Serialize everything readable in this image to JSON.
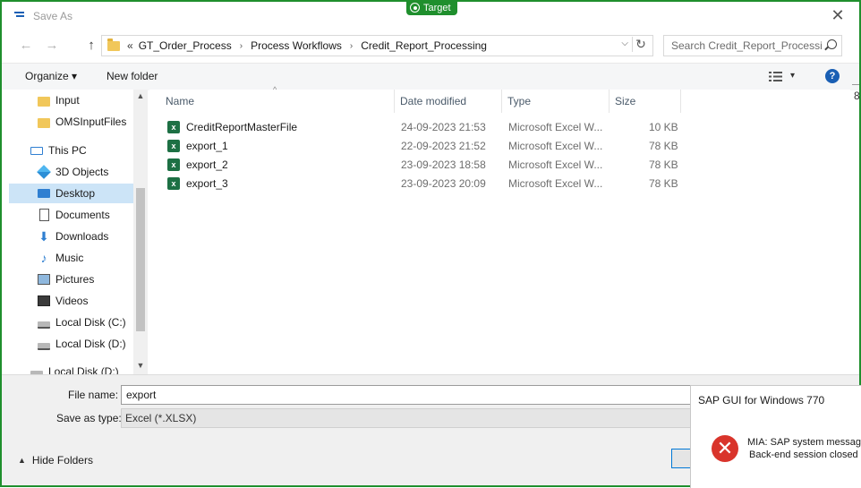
{
  "window": {
    "title": "Save As",
    "close_glyph": "✕"
  },
  "target_badge": "Target",
  "nav": {
    "back": "←",
    "forward": "→",
    "up": "↑"
  },
  "address": {
    "overflow": "«",
    "crumbs": [
      "GT_Order_Process",
      "Process Workflows",
      "Credit_Report_Processing"
    ],
    "separator": "›",
    "dropdown": "⌵",
    "refresh": "↻"
  },
  "search": {
    "placeholder": "Search Credit_Report_Processi..."
  },
  "toolbar": {
    "organize": "Organize ▾",
    "new_folder": "New folder",
    "view_dd": "▾",
    "help": "?"
  },
  "sidebar": {
    "items": [
      {
        "label": "Input",
        "icon": "folder-icon"
      },
      {
        "label": "OMSInputFiles",
        "icon": "folder-icon"
      },
      {
        "label": "This PC",
        "icon": "computer-icon"
      },
      {
        "label": "3D Objects",
        "icon": "cube-icon"
      },
      {
        "label": "Desktop",
        "icon": "desktop-icon",
        "selected": true
      },
      {
        "label": "Documents",
        "icon": "document-icon"
      },
      {
        "label": "Downloads",
        "icon": "download-icon"
      },
      {
        "label": "Music",
        "icon": "music-icon"
      },
      {
        "label": "Pictures",
        "icon": "pictures-icon"
      },
      {
        "label": "Videos",
        "icon": "videos-icon"
      },
      {
        "label": "Local Disk (C:)",
        "icon": "disk-icon"
      },
      {
        "label": "Local Disk (D:)",
        "icon": "disk-icon"
      },
      {
        "label": "Local Disk (D:)",
        "icon": "disk-icon"
      }
    ],
    "scroll_up": "▲",
    "scroll_down": "▼"
  },
  "columns": {
    "name": "Name",
    "date": "Date modified",
    "type": "Type",
    "size": "Size",
    "sort_caret": "^"
  },
  "files": [
    {
      "name": "CreditReportMasterFile",
      "date": "24-09-2023 21:53",
      "type": "Microsoft Excel W...",
      "size": "10 KB"
    },
    {
      "name": "export_1",
      "date": "22-09-2023 21:52",
      "type": "Microsoft Excel W...",
      "size": "78 KB"
    },
    {
      "name": "export_2",
      "date": "23-09-2023 18:58",
      "type": "Microsoft Excel W...",
      "size": "78 KB"
    },
    {
      "name": "export_3",
      "date": "23-09-2023 20:09",
      "type": "Microsoft Excel W...",
      "size": "78 KB"
    }
  ],
  "excel_icon_letter": "x",
  "bottom": {
    "file_name_label": "File name:",
    "file_name_value": "export",
    "save_type_label": "Save as type:",
    "save_type_value": "Excel (*.XLSX)",
    "hide_folders": "Hide Folders",
    "hide_caret": "▲"
  },
  "sap_popup": {
    "title": "SAP GUI for Windows 770",
    "error_glyph": "✕",
    "message_line1": "MIA: SAP system message",
    "message_line2": "Back-end session closed"
  },
  "edge_digit": "8"
}
